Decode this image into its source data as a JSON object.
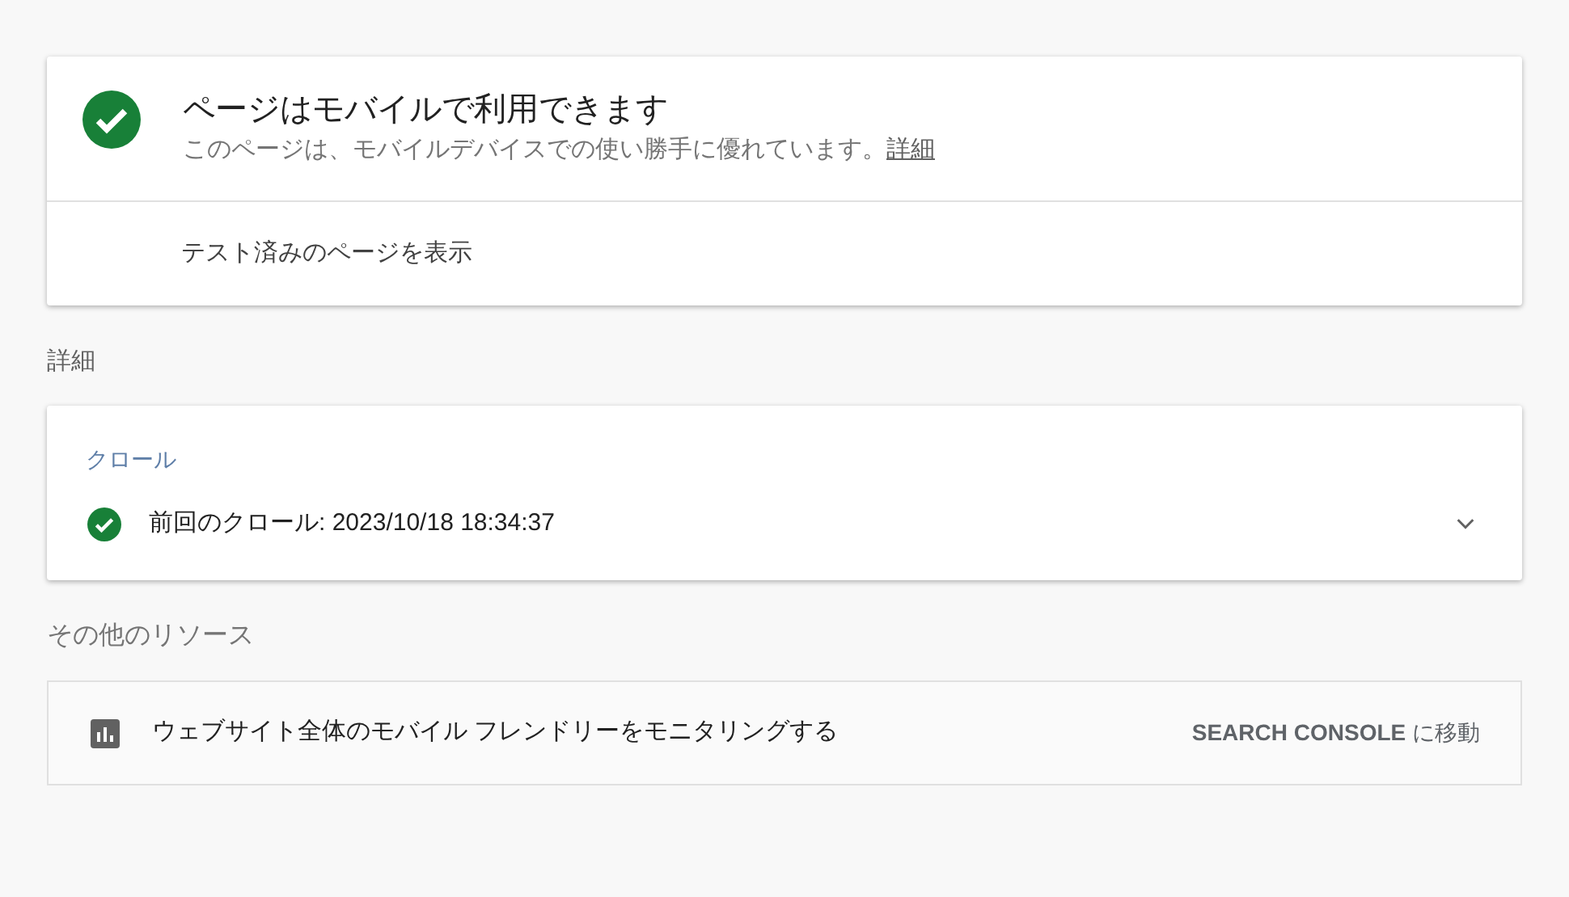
{
  "result": {
    "title": "ページはモバイルで利用できます",
    "summary": "このページは、モバイルデバイスでの使い勝手に優れています。",
    "summary_link": "詳細",
    "view_tested_page": "テスト済みのページを表示"
  },
  "details": {
    "heading": "詳細",
    "section_title": "クロール",
    "crawl": {
      "text": "前回のクロール: 2023/10/18 18:34:37",
      "expanded": false
    }
  },
  "resources": {
    "heading": "その他のリソース",
    "item": {
      "text": "ウェブサイト全体のモバイル フレンドリーをモニタリングする",
      "action": "**SEARCH CONSOLE** に移動"
    }
  }
}
